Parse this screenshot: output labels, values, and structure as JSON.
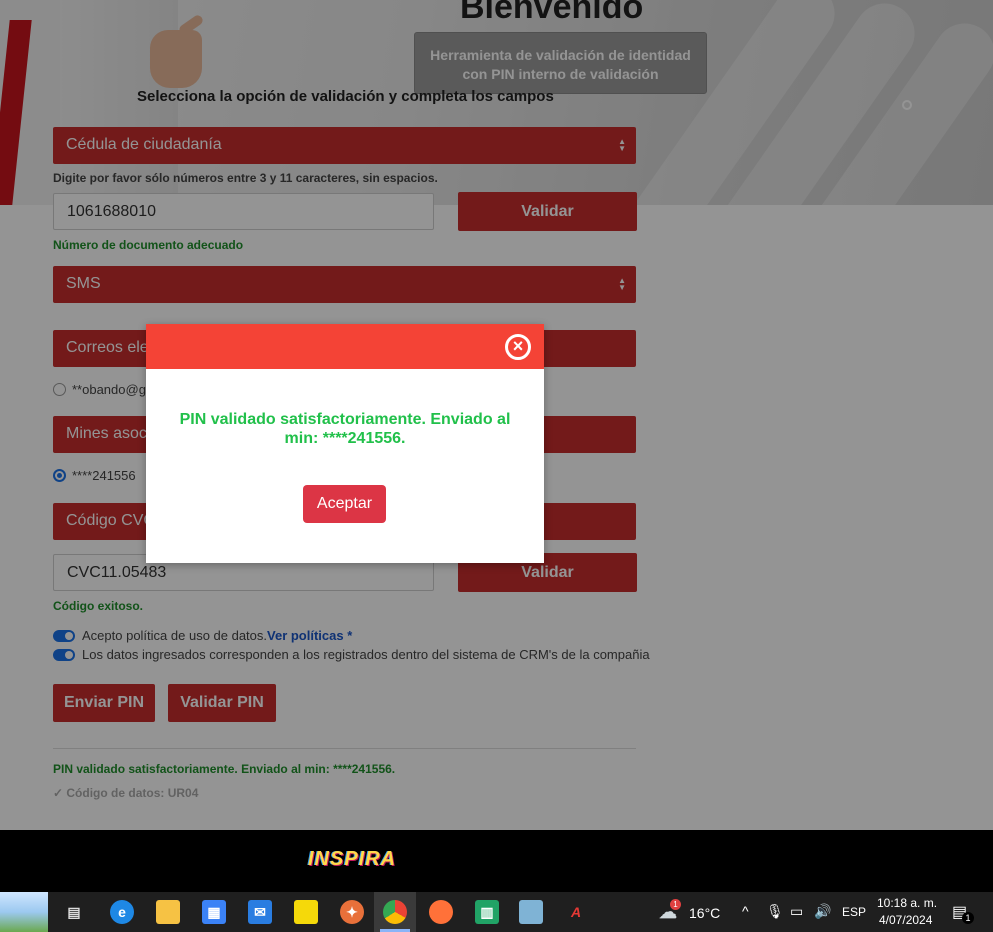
{
  "header": {
    "welcome": "Bienvenido",
    "tool_line1": "Herramienta de validación de identidad",
    "tool_line2": "con PIN interno de validación",
    "instructions": "Selecciona la opción de validación y completa los campos"
  },
  "form": {
    "doc_type": "Cédula de ciudadanía",
    "doc_hint": "Digite por favor sólo números entre 3 y 11 caracteres, sin espacios.",
    "doc_number": "1061688010",
    "validate_label": "Validar",
    "doc_ok": "Número de documento adecuado",
    "channel": "SMS",
    "email_select": "Correos ele",
    "email_option": "**obando@g",
    "lines_select": "Mines asoc",
    "phone_option": "****241556",
    "code_select": "Código CVC",
    "code_value": "CVC11.05483",
    "code_validate_label": "Validar",
    "code_ok": "Código exitoso.",
    "policy_text": "Acepto política de uso de datos.",
    "policy_link": "Ver políticas *",
    "crm_text": "Los datos ingresados corresponden a los registrados dentro del sistema de CRM's de la compañia",
    "send_pin": "Enviar PIN",
    "validate_pin": "Validar PIN",
    "result": "PIN validado satisfactoriamente. Enviado al min: ****241556.",
    "data_code": "✓ Código de datos: UR04"
  },
  "modal": {
    "close_icon": "close-circle-icon",
    "message": "PIN validado satisfactoriamente. Enviado al min: ****241556.",
    "accept": "Aceptar"
  },
  "footer": {
    "logo_text": "INSPIRA"
  },
  "taskbar": {
    "weather_badge": "1",
    "temperature": "16°C",
    "language": "ESP",
    "time": "10:18 a. m.",
    "date": "4/07/2024",
    "notification_count": "1"
  },
  "colors": {
    "primary_red": "#c62e2e",
    "modal_header": "#f44336",
    "success_green": "#21c04a",
    "accept_button": "#dc3545"
  }
}
